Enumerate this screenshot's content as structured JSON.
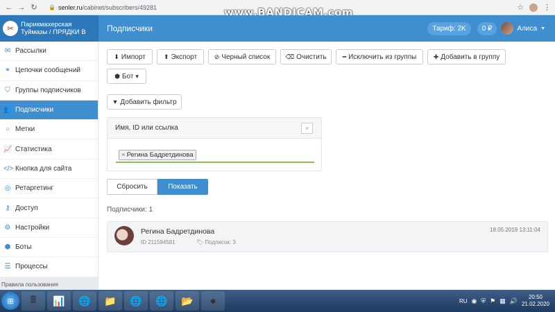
{
  "browser": {
    "url_host": "senler.ru",
    "url_path": "/cabinet/subscribers/49281"
  },
  "watermark": "www.BANDICAM.com",
  "header": {
    "brand_name_1": "Парикмахерская",
    "brand_name_2": "Туймазы / ПРЯДКИ В",
    "title": "Подписчики",
    "tariff": "Тариф: 2K",
    "balance": "0 ₽",
    "user_name": "Алиса"
  },
  "sidebar": {
    "items": [
      {
        "label": "Рассылки",
        "icon": "envelope-icon"
      },
      {
        "label": "Цепочки сообщений",
        "icon": "link-icon"
      },
      {
        "label": "Группы подписчиков",
        "icon": "tag-icon"
      },
      {
        "label": "Подписчики",
        "icon": "users-icon",
        "active": true
      },
      {
        "label": "Метки",
        "icon": "circle-icon"
      },
      {
        "label": "Статистика",
        "icon": "chart-icon"
      },
      {
        "label": "Кнопка для сайта",
        "icon": "code-icon"
      },
      {
        "label": "Ретаргетинг",
        "icon": "target-icon"
      },
      {
        "label": "Доступ",
        "icon": "key-icon"
      },
      {
        "label": "Настройки",
        "icon": "gears-icon"
      },
      {
        "label": "Боты",
        "icon": "android-icon"
      },
      {
        "label": "Процессы",
        "icon": "list-icon"
      }
    ],
    "footer": "Правила пользования"
  },
  "toolbar": {
    "import": "Импорт",
    "export": "Экспорт",
    "blacklist": "Черный список",
    "clear": "Очистить",
    "exclude": "Исключить из группы",
    "add_to_group": "Добавить в группу",
    "bot": "Бот",
    "add_filter": "Добавить фильтр"
  },
  "filter": {
    "title": "Имя, ID или ссылка",
    "tag": "Регина Бадретдинова",
    "close": "×",
    "reset": "Сбросить",
    "show": "Показать"
  },
  "results": {
    "count_label": "Подписчики: 1",
    "subscriber": {
      "name": "Регина Бадретдинова",
      "id": "ID 211594581",
      "subscriptions": "Подписок: 3",
      "date": "18.05.2019 13:11:04"
    }
  },
  "taskbar": {
    "lang": "RU",
    "time": "20:50",
    "date": "21.02.2020"
  },
  "colors": {
    "accent": "#3e8ed0",
    "brand": "#2c78bb",
    "success": "#8cc152"
  }
}
